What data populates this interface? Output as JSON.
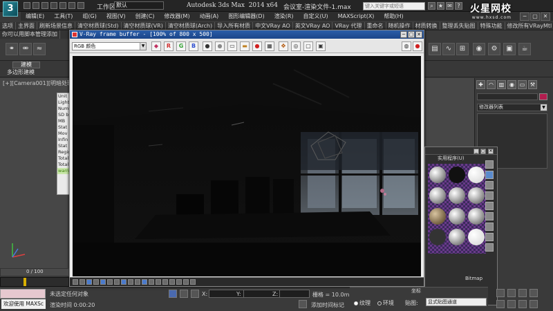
{
  "app": {
    "logo_glyph": "3",
    "workspace_label": "工作区:",
    "workspace_value": "默认",
    "title": "Autodesk 3ds Max  2014 x64",
    "file_name": "会议室-渲染文件-1.max",
    "search_placeholder": "键入关键字或短语",
    "window_controls": [
      "─",
      "▢",
      "✕"
    ]
  },
  "watermark": {
    "main": "火星网校",
    "sub": "www.hxsd.com"
  },
  "menu": [
    "编辑(E)",
    "工具(T)",
    "组(G)",
    "视图(V)",
    "创建(C)",
    "修改器(M)",
    "动画(A)",
    "图形编辑器(D)",
    "渲染(R)",
    "自定义(U)",
    "MAXScript(X)",
    "帮助(H)"
  ],
  "ribbon_tabs": [
    "选项",
    "主界面",
    "刷新场景信息",
    "清空材质球(Std)",
    "清空材质球(VR)",
    "清空材质球(Arch)",
    "导入所有材质",
    "中文VRay AO",
    "英文VRay AO",
    "VRay 代理",
    "重命名",
    "随机操作",
    "材质转换",
    "整理丢失贴图",
    "特殊功能",
    "修改所有VRayMtl"
  ],
  "ribbon_tabs_row2": [
    "你可以用脚本管理添加"
  ],
  "graphite": {
    "tab": "建模",
    "label": "多边形建模"
  },
  "viewport": {
    "label": "[+][Camera001][明暗处理]"
  },
  "side_list": [
    "Unit",
    "Light",
    "Numb",
    "SD b",
    "MB",
    "Stat",
    "Mov",
    "Infin",
    "Stat",
    "Regio",
    "Total",
    "Total",
    "warn"
  ],
  "vfb": {
    "title": "V-Ray frame buffer - [100% of 800 x 500]",
    "channel": "RGB 颜色",
    "color_buttons": [
      "R",
      "G",
      "B"
    ]
  },
  "material_editor": {
    "utilities_label": "实用程序(U)",
    "bitmap_label": "Bitmap"
  },
  "coord_group": {
    "title": "坐标",
    "texture_label": "纹理",
    "environment_label": "环境",
    "map_label": "贴图:",
    "map_value": "显式贴图通道"
  },
  "command_panel": {
    "modifier_list": "修改器列表",
    "object_color": "#b21c4e"
  },
  "timeline": {
    "frame_counter": "0 / 100",
    "marker_color": "#d8b000"
  },
  "status": {
    "welcome": "欢迎使用 MAXSc",
    "message": "未选定任何对象",
    "render_time": "渲染时间  0:00:20",
    "x_label": "X:",
    "y_label": "Y:",
    "z_label": "Z:",
    "grid": "栅格 = 10.0m",
    "add_time_tag": "添加时间标记"
  }
}
